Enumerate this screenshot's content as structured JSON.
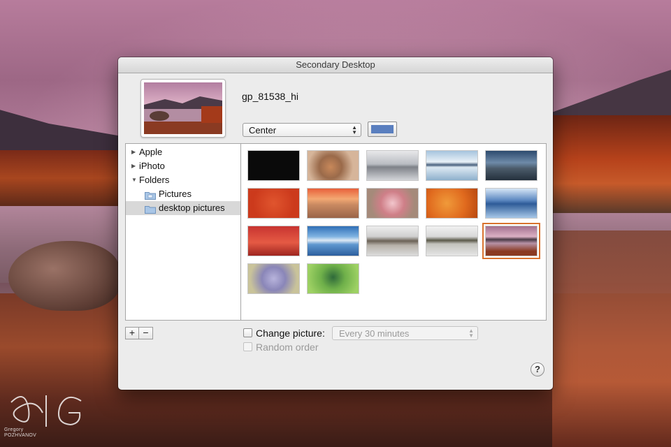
{
  "window": {
    "title": "Secondary Desktop"
  },
  "preview": {
    "file_name": "gp_81538_hi"
  },
  "fit_menu": {
    "selected": "Center"
  },
  "color_well": {
    "color": "#5a7fbf"
  },
  "sources": [
    {
      "label": "Apple",
      "disclosure": "▶",
      "indent": false,
      "icon": null,
      "selected": false
    },
    {
      "label": "iPhoto",
      "disclosure": "▶",
      "indent": false,
      "icon": null,
      "selected": false
    },
    {
      "label": "Folders",
      "disclosure": "▼",
      "indent": false,
      "icon": null,
      "selected": false
    },
    {
      "label": "Pictures",
      "disclosure": "",
      "indent": true,
      "icon": "pictures-folder-icon",
      "selected": false
    },
    {
      "label": "desktop pictures",
      "disclosure": "",
      "indent": true,
      "icon": "folder-icon",
      "selected": true
    }
  ],
  "thumbnails": [
    {
      "name": "black",
      "selected": false
    },
    {
      "name": "dry-flower-macro",
      "selected": false
    },
    {
      "name": "misty-lake-gray",
      "selected": false
    },
    {
      "name": "mountain-lake-reflection",
      "selected": false
    },
    {
      "name": "rocky-coast-blue",
      "selected": false
    },
    {
      "name": "red-with-droplets",
      "selected": false
    },
    {
      "name": "desert-sunset-crater",
      "selected": false
    },
    {
      "name": "pink-blossoms",
      "selected": false
    },
    {
      "name": "orange-leaf",
      "selected": false
    },
    {
      "name": "blue-lake-long-exposure",
      "selected": false
    },
    {
      "name": "palm-silhouette-red",
      "selected": false
    },
    {
      "name": "city-skyline-reflection",
      "selected": false
    },
    {
      "name": "autumn-lake-gray",
      "selected": false
    },
    {
      "name": "lake-with-trees",
      "selected": false
    },
    {
      "name": "purple-lake-rock",
      "selected": true
    },
    {
      "name": "wildflowers-bokeh",
      "selected": false
    },
    {
      "name": "green-bug-flying",
      "selected": false
    }
  ],
  "buttons": {
    "add": "+",
    "remove": "−",
    "help": "?"
  },
  "change_picture": {
    "label": "Change picture:",
    "checked": false,
    "interval": "Every 30 minutes"
  },
  "random_order": {
    "label": "Random order",
    "checked": false,
    "enabled": false
  },
  "watermark": {
    "line1": "Gregory",
    "line2": "POZHVANOV"
  }
}
